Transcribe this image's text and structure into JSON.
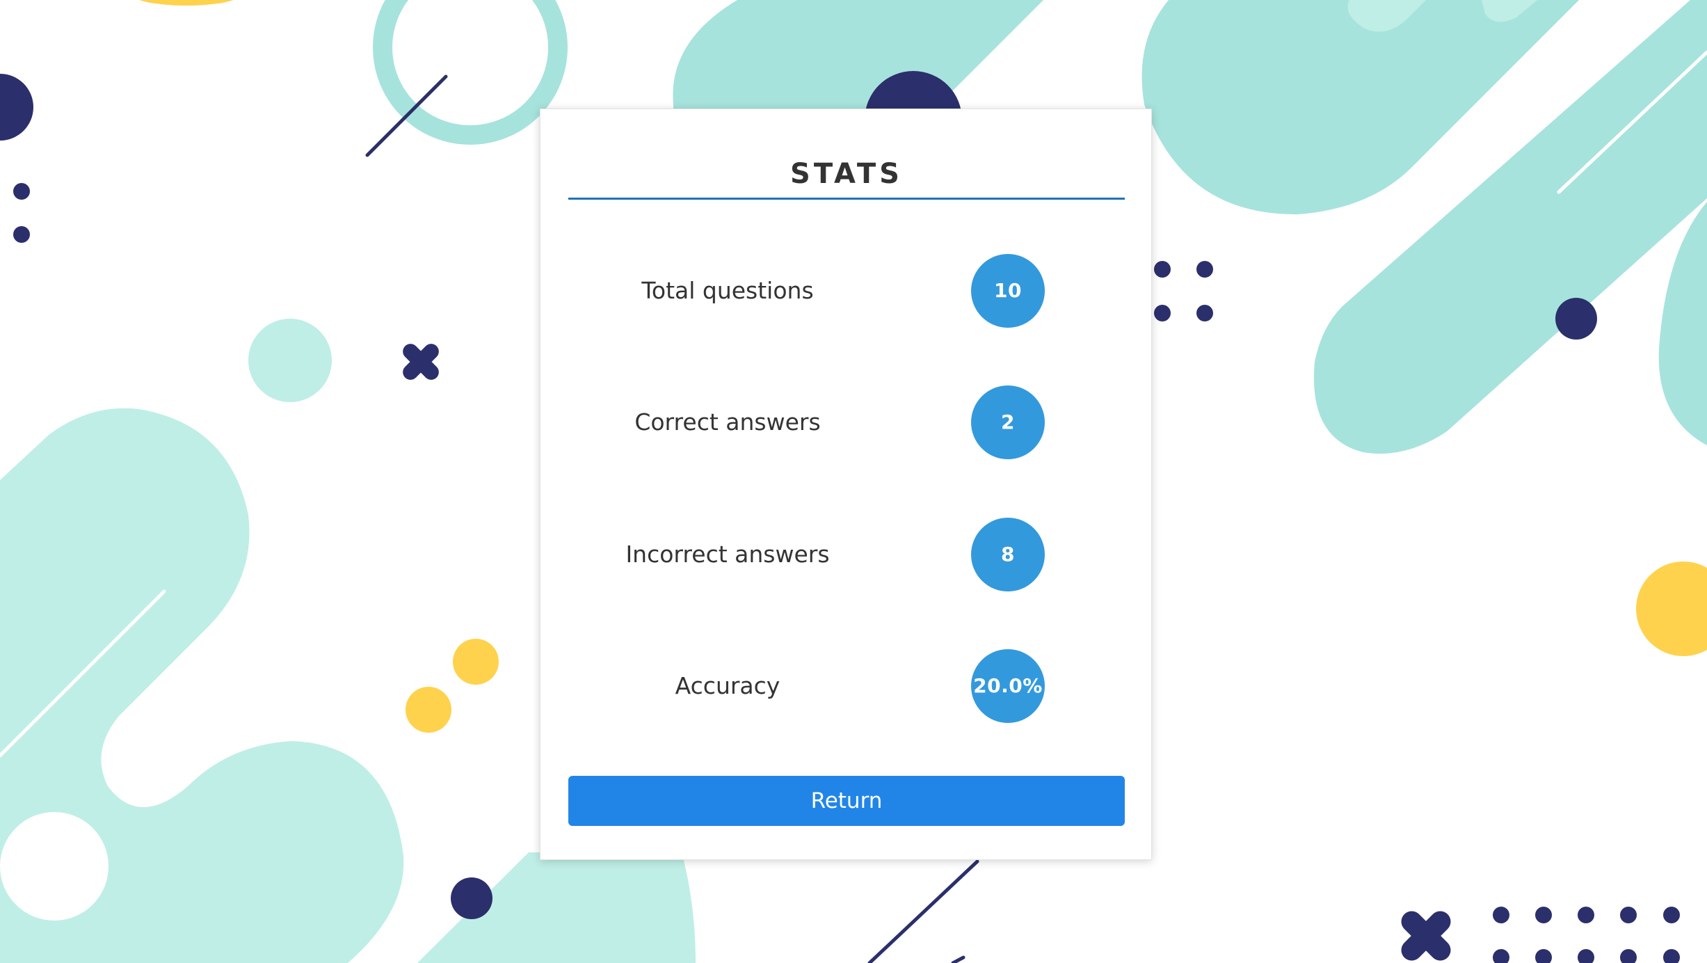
{
  "stats_panel": {
    "title": "STATS",
    "rows": [
      {
        "label": "Total questions",
        "value": "10"
      },
      {
        "label": "Correct answers",
        "value": "2"
      },
      {
        "label": "Incorrect answers",
        "value": "8"
      },
      {
        "label": "Accuracy",
        "value": "20.0%"
      }
    ],
    "return_label": "Return"
  },
  "colors": {
    "accent": "#2185e8",
    "badge": "#3399dd",
    "title_rule": "#1e72b9",
    "mint": "#a6e3dc",
    "navy": "#2b2f6b",
    "yellow": "#ffd24d"
  },
  "icons": [
    "x-cross-icon"
  ]
}
